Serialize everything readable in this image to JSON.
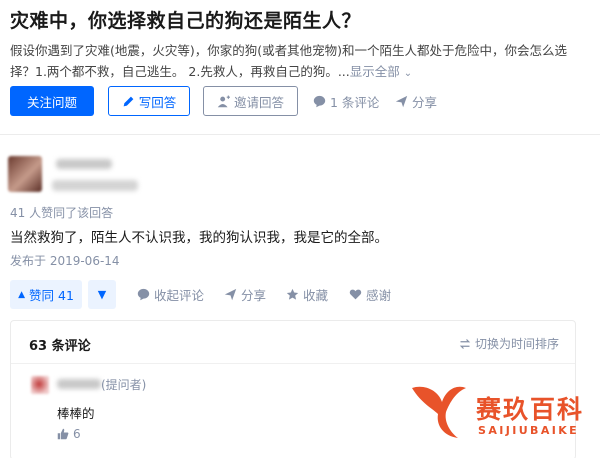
{
  "question": {
    "title": "灾难中，你选择救自己的狗还是陌生人？",
    "excerpt": "假设你遇到了灾难(地震，火灾等)，你家的狗(或者其他宠物)和一个陌生人都处于危险中，你会怎么选择？1.两个都不救，自己逃生。 2.先救人，再救自己的狗。...",
    "show_all": "显示全部"
  },
  "actions": {
    "follow": "关注问题",
    "write": "写回答",
    "invite": "邀请回答",
    "comments": "1 条评论",
    "share": "分享"
  },
  "answer": {
    "voters": "41 人赞同了该回答",
    "content": "当然救狗了，陌生人不认识我，我的狗认识我，我是它的全部。",
    "date": "发布于 2019-06-14",
    "vote_up": "赞同 41",
    "collapse_comments": "收起评论",
    "share": "分享",
    "favorite": "收藏",
    "thanks": "感谢"
  },
  "comments": {
    "count": "63 条评论",
    "sort": "切换为时间排序",
    "items": [
      {
        "tag": "(提问者)",
        "text": "棒棒的",
        "likes": "6"
      }
    ]
  },
  "watermark": {
    "cn": "赛玖百科",
    "en": "SAIJIUBAIKE",
    "color": "#e8532a"
  },
  "colors": {
    "primary": "#0066ff",
    "muted": "#8590a6"
  }
}
